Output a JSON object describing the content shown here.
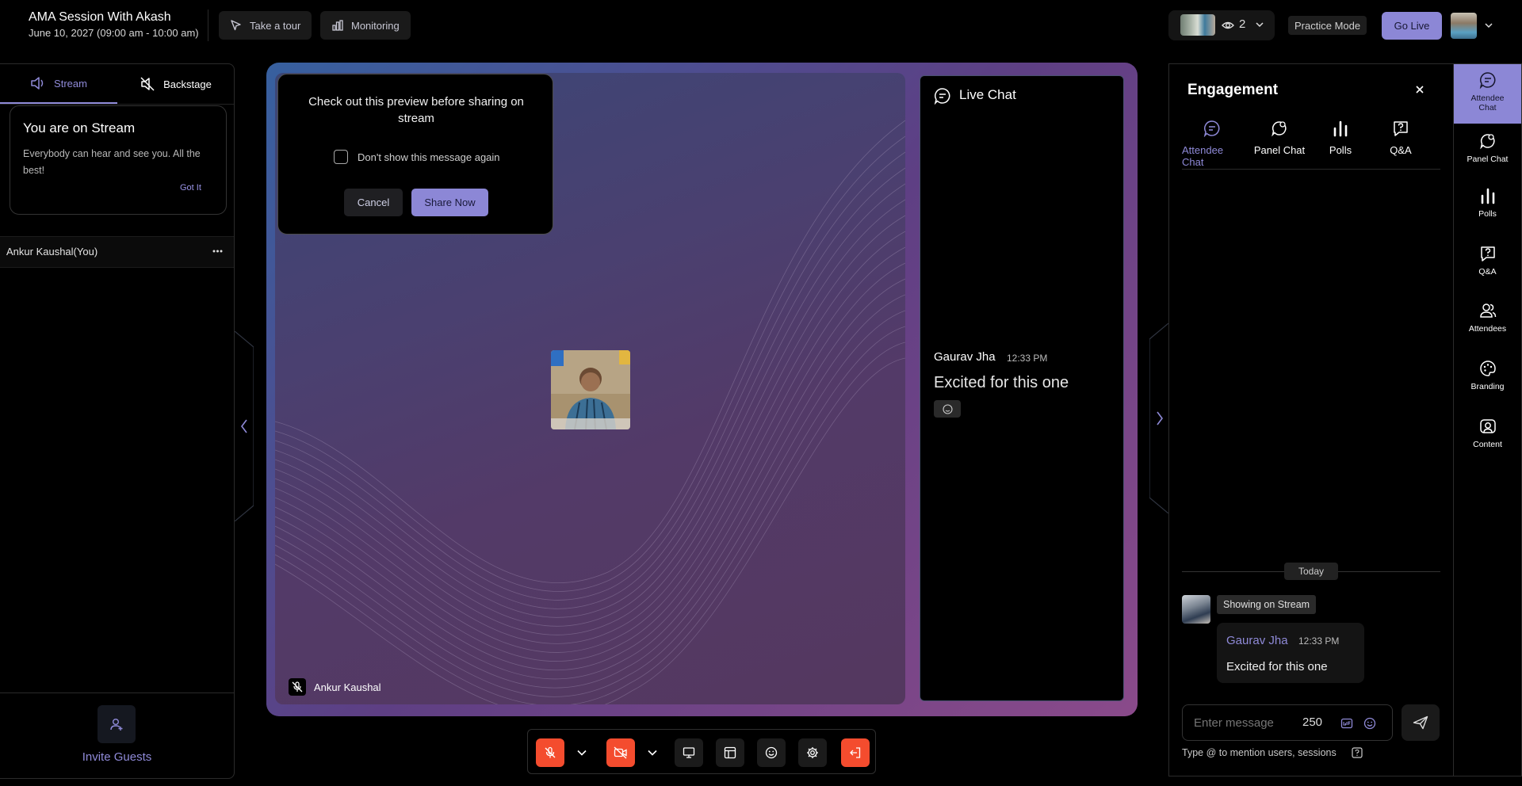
{
  "header": {
    "session_title": "AMA Session With Akash",
    "session_date": "June 10, 2027 (09:00 am - 10:00 am)",
    "take_tour_label": "Take a tour",
    "monitoring_label": "Monitoring",
    "viewer_count": "2",
    "practice_mode_label": "Practice Mode",
    "go_live_label": "Go Live"
  },
  "left_panel": {
    "tabs": [
      {
        "label": "Stream",
        "icon": "speaker-icon",
        "active": true
      },
      {
        "label": "Backstage",
        "icon": "speaker-off-icon",
        "active": false
      }
    ],
    "notice_title": "You are on Stream",
    "notice_body": "Everybody can hear and see you. All the best!",
    "notice_action": "Got It",
    "participant_name": "Ankur Kaushal(You)",
    "invite_label": "Invite Guests"
  },
  "preview": {
    "message": "Check out this preview before sharing on stream",
    "checkbox_label": "Don't show this message again",
    "checkbox_checked": false,
    "cancel_label": "Cancel",
    "share_label": "Share Now"
  },
  "stage": {
    "speaker_name": "Ankur Kaushal",
    "live_chat_title": "Live Chat",
    "chat_author": "Gaurav Jha",
    "chat_time": "12:33 PM",
    "chat_text": "Excited for this one"
  },
  "engagement": {
    "title": "Engagement",
    "tabs": [
      {
        "label": "Attendee Chat",
        "icon": "chat-bubble-icon",
        "active": true
      },
      {
        "label": "Panel Chat",
        "icon": "panel-chat-icon",
        "active": false
      },
      {
        "label": "Polls",
        "icon": "bar-chart-icon",
        "active": false
      },
      {
        "label": "Q&A",
        "icon": "question-icon",
        "active": false
      }
    ],
    "date_divider": "Today",
    "stream_badge": "Showing on Stream",
    "message_author": "Gaurav Jha",
    "message_time": "12:33 PM",
    "message_text": "Excited for this one",
    "input_placeholder": "Enter message",
    "char_limit": "250",
    "mention_hint": "Type @ to mention users, sessions"
  },
  "rail": {
    "items": [
      {
        "label": "Attendee Chat",
        "icon": "chat-bubble-icon",
        "active": true
      },
      {
        "label": "Panel Chat",
        "icon": "panel-chat-icon",
        "active": false
      },
      {
        "label": "Polls",
        "icon": "bar-chart-icon",
        "active": false
      },
      {
        "label": "Q&A",
        "icon": "question-icon",
        "active": false
      },
      {
        "label": "Attendees",
        "icon": "users-icon",
        "active": false
      },
      {
        "label": "Branding",
        "icon": "palette-icon",
        "active": false
      },
      {
        "label": "Content",
        "icon": "content-icon",
        "active": false
      }
    ]
  },
  "colors": {
    "accent": "#8c87d6",
    "danger": "#f44c2e",
    "background": "#000000"
  }
}
